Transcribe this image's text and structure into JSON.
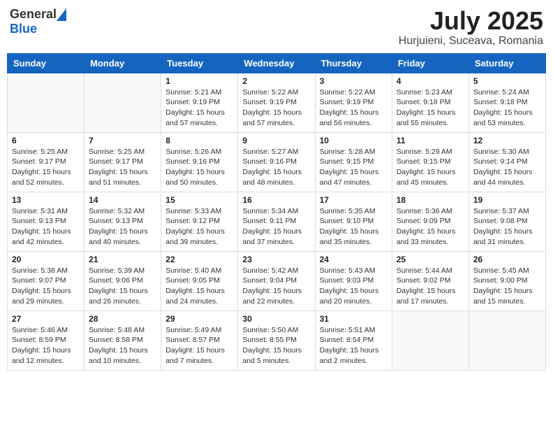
{
  "header": {
    "logo_general": "General",
    "logo_blue": "Blue",
    "month_year": "July 2025",
    "location": "Hurjuieni, Suceava, Romania"
  },
  "days_of_week": [
    "Sunday",
    "Monday",
    "Tuesday",
    "Wednesday",
    "Thursday",
    "Friday",
    "Saturday"
  ],
  "weeks": [
    [
      {
        "day": "",
        "sunrise": "",
        "sunset": "",
        "daylight": ""
      },
      {
        "day": "",
        "sunrise": "",
        "sunset": "",
        "daylight": ""
      },
      {
        "day": "1",
        "sunrise": "Sunrise: 5:21 AM",
        "sunset": "Sunset: 9:19 PM",
        "daylight": "Daylight: 15 hours and 57 minutes."
      },
      {
        "day": "2",
        "sunrise": "Sunrise: 5:22 AM",
        "sunset": "Sunset: 9:19 PM",
        "daylight": "Daylight: 15 hours and 57 minutes."
      },
      {
        "day": "3",
        "sunrise": "Sunrise: 5:22 AM",
        "sunset": "Sunset: 9:19 PM",
        "daylight": "Daylight: 15 hours and 56 minutes."
      },
      {
        "day": "4",
        "sunrise": "Sunrise: 5:23 AM",
        "sunset": "Sunset: 9:18 PM",
        "daylight": "Daylight: 15 hours and 55 minutes."
      },
      {
        "day": "5",
        "sunrise": "Sunrise: 5:24 AM",
        "sunset": "Sunset: 9:18 PM",
        "daylight": "Daylight: 15 hours and 53 minutes."
      }
    ],
    [
      {
        "day": "6",
        "sunrise": "Sunrise: 5:25 AM",
        "sunset": "Sunset: 9:17 PM",
        "daylight": "Daylight: 15 hours and 52 minutes."
      },
      {
        "day": "7",
        "sunrise": "Sunrise: 5:25 AM",
        "sunset": "Sunset: 9:17 PM",
        "daylight": "Daylight: 15 hours and 51 minutes."
      },
      {
        "day": "8",
        "sunrise": "Sunrise: 5:26 AM",
        "sunset": "Sunset: 9:16 PM",
        "daylight": "Daylight: 15 hours and 50 minutes."
      },
      {
        "day": "9",
        "sunrise": "Sunrise: 5:27 AM",
        "sunset": "Sunset: 9:16 PM",
        "daylight": "Daylight: 15 hours and 48 minutes."
      },
      {
        "day": "10",
        "sunrise": "Sunrise: 5:28 AM",
        "sunset": "Sunset: 9:15 PM",
        "daylight": "Daylight: 15 hours and 47 minutes."
      },
      {
        "day": "11",
        "sunrise": "Sunrise: 5:29 AM",
        "sunset": "Sunset: 9:15 PM",
        "daylight": "Daylight: 15 hours and 45 minutes."
      },
      {
        "day": "12",
        "sunrise": "Sunrise: 5:30 AM",
        "sunset": "Sunset: 9:14 PM",
        "daylight": "Daylight: 15 hours and 44 minutes."
      }
    ],
    [
      {
        "day": "13",
        "sunrise": "Sunrise: 5:31 AM",
        "sunset": "Sunset: 9:13 PM",
        "daylight": "Daylight: 15 hours and 42 minutes."
      },
      {
        "day": "14",
        "sunrise": "Sunrise: 5:32 AM",
        "sunset": "Sunset: 9:13 PM",
        "daylight": "Daylight: 15 hours and 40 minutes."
      },
      {
        "day": "15",
        "sunrise": "Sunrise: 5:33 AM",
        "sunset": "Sunset: 9:12 PM",
        "daylight": "Daylight: 15 hours and 39 minutes."
      },
      {
        "day": "16",
        "sunrise": "Sunrise: 5:34 AM",
        "sunset": "Sunset: 9:11 PM",
        "daylight": "Daylight: 15 hours and 37 minutes."
      },
      {
        "day": "17",
        "sunrise": "Sunrise: 5:35 AM",
        "sunset": "Sunset: 9:10 PM",
        "daylight": "Daylight: 15 hours and 35 minutes."
      },
      {
        "day": "18",
        "sunrise": "Sunrise: 5:36 AM",
        "sunset": "Sunset: 9:09 PM",
        "daylight": "Daylight: 15 hours and 33 minutes."
      },
      {
        "day": "19",
        "sunrise": "Sunrise: 5:37 AM",
        "sunset": "Sunset: 9:08 PM",
        "daylight": "Daylight: 15 hours and 31 minutes."
      }
    ],
    [
      {
        "day": "20",
        "sunrise": "Sunrise: 5:38 AM",
        "sunset": "Sunset: 9:07 PM",
        "daylight": "Daylight: 15 hours and 29 minutes."
      },
      {
        "day": "21",
        "sunrise": "Sunrise: 5:39 AM",
        "sunset": "Sunset: 9:06 PM",
        "daylight": "Daylight: 15 hours and 26 minutes."
      },
      {
        "day": "22",
        "sunrise": "Sunrise: 5:40 AM",
        "sunset": "Sunset: 9:05 PM",
        "daylight": "Daylight: 15 hours and 24 minutes."
      },
      {
        "day": "23",
        "sunrise": "Sunrise: 5:42 AM",
        "sunset": "Sunset: 9:04 PM",
        "daylight": "Daylight: 15 hours and 22 minutes."
      },
      {
        "day": "24",
        "sunrise": "Sunrise: 5:43 AM",
        "sunset": "Sunset: 9:03 PM",
        "daylight": "Daylight: 15 hours and 20 minutes."
      },
      {
        "day": "25",
        "sunrise": "Sunrise: 5:44 AM",
        "sunset": "Sunset: 9:02 PM",
        "daylight": "Daylight: 15 hours and 17 minutes."
      },
      {
        "day": "26",
        "sunrise": "Sunrise: 5:45 AM",
        "sunset": "Sunset: 9:00 PM",
        "daylight": "Daylight: 15 hours and 15 minutes."
      }
    ],
    [
      {
        "day": "27",
        "sunrise": "Sunrise: 5:46 AM",
        "sunset": "Sunset: 8:59 PM",
        "daylight": "Daylight: 15 hours and 12 minutes."
      },
      {
        "day": "28",
        "sunrise": "Sunrise: 5:48 AM",
        "sunset": "Sunset: 8:58 PM",
        "daylight": "Daylight: 15 hours and 10 minutes."
      },
      {
        "day": "29",
        "sunrise": "Sunrise: 5:49 AM",
        "sunset": "Sunset: 8:57 PM",
        "daylight": "Daylight: 15 hours and 7 minutes."
      },
      {
        "day": "30",
        "sunrise": "Sunrise: 5:50 AM",
        "sunset": "Sunset: 8:55 PM",
        "daylight": "Daylight: 15 hours and 5 minutes."
      },
      {
        "day": "31",
        "sunrise": "Sunrise: 5:51 AM",
        "sunset": "Sunset: 8:54 PM",
        "daylight": "Daylight: 15 hours and 2 minutes."
      },
      {
        "day": "",
        "sunrise": "",
        "sunset": "",
        "daylight": ""
      },
      {
        "day": "",
        "sunrise": "",
        "sunset": "",
        "daylight": ""
      }
    ]
  ]
}
